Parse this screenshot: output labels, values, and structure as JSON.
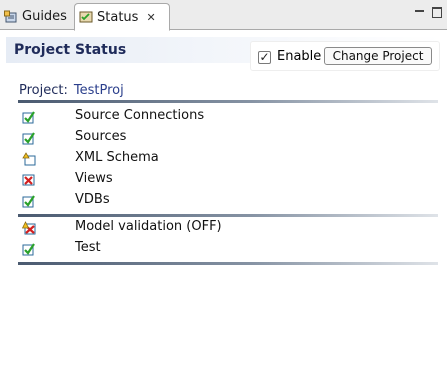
{
  "tabs": [
    {
      "label": "Guides",
      "icon": "guides-icon",
      "active": false
    },
    {
      "label": "Status",
      "icon": "status-icon",
      "active": true
    }
  ],
  "header": {
    "title": "Project Status",
    "enable_label": "Enable",
    "enable_checked": true,
    "change_project_label": "Change Project"
  },
  "project": {
    "label": "Project:",
    "name": "TestProj"
  },
  "status_groups": [
    {
      "items": [
        {
          "label": "Source Connections",
          "status": "ok",
          "icon": "green-check-icon"
        },
        {
          "label": "Sources",
          "status": "ok",
          "icon": "green-check-icon"
        },
        {
          "label": "XML Schema",
          "status": "warning",
          "icon": "warning-box-icon"
        },
        {
          "label": "Views",
          "status": "error",
          "icon": "red-x-icon"
        },
        {
          "label": "VDBs",
          "status": "ok",
          "icon": "green-check-icon"
        }
      ]
    },
    {
      "items": [
        {
          "label": "Model validation (OFF)",
          "status": "off",
          "icon": "validation-off-icon"
        },
        {
          "label": "Test",
          "status": "ok",
          "icon": "green-check-icon"
        }
      ]
    }
  ],
  "colors": {
    "title": "#1f2b5a",
    "link": "#2b3f8c",
    "ok": "#2aa12a",
    "error": "#d42020",
    "warning": "#e0b020"
  }
}
